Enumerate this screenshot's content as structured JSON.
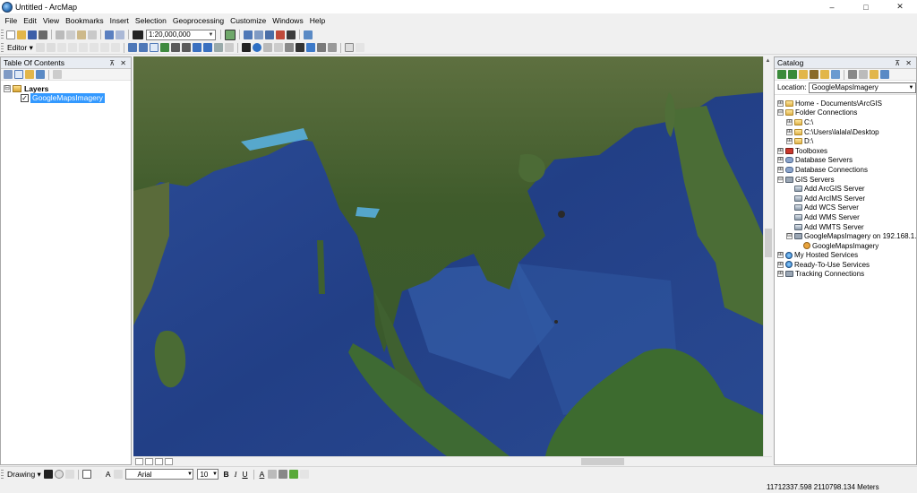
{
  "window": {
    "title": "Untitled - ArcMap",
    "minimize": "–",
    "maximize": "□",
    "close": "✕"
  },
  "menu": [
    "File",
    "Edit",
    "View",
    "Bookmarks",
    "Insert",
    "Selection",
    "Geoprocessing",
    "Customize",
    "Windows",
    "Help"
  ],
  "standard_toolbar": {
    "scale": "1:20,000,000"
  },
  "editor_toolbar": {
    "label": "Editor ▾"
  },
  "toc": {
    "title": "Table Of Contents",
    "pin_close": "⊼ ✕",
    "group": {
      "expander": "⊟",
      "label": "Layers"
    },
    "layers": [
      {
        "name": "GoogleMapsImagery",
        "checked": "✓"
      }
    ]
  },
  "catalog": {
    "title": "Catalog",
    "pin_close": "⊼ ✕",
    "location_label": "Location:",
    "location_value": "GoogleMapsImagery",
    "tree": [
      {
        "label": "Home - Documents\\ArcGIS",
        "exp": "⊞"
      },
      {
        "label": "Folder Connections",
        "exp": "⊟"
      },
      {
        "label": "C:\\",
        "exp": "⊞"
      },
      {
        "label": "C:\\Users\\lalala\\Desktop",
        "exp": "⊞"
      },
      {
        "label": "D:\\",
        "exp": "⊞"
      },
      {
        "label": "Toolboxes",
        "exp": "⊞"
      },
      {
        "label": "Database Servers",
        "exp": "⊞"
      },
      {
        "label": "Database Connections",
        "exp": "⊞"
      },
      {
        "label": "GIS Servers",
        "exp": "⊟"
      },
      {
        "label": "Add ArcGIS Server",
        "exp": ""
      },
      {
        "label": "Add ArcIMS Server",
        "exp": ""
      },
      {
        "label": "Add WCS Server",
        "exp": ""
      },
      {
        "label": "Add WMS Server",
        "exp": ""
      },
      {
        "label": "Add WMTS Server",
        "exp": ""
      },
      {
        "label": "GoogleMapsImagery on 192.168.1.",
        "exp": "⊟"
      },
      {
        "label": "GoogleMapsImagery",
        "exp": ""
      },
      {
        "label": "My Hosted Services",
        "exp": "⊞"
      },
      {
        "label": "Ready-To-Use Services",
        "exp": "⊞"
      },
      {
        "label": "Tracking Connections",
        "exp": "⊞"
      }
    ]
  },
  "drawing_toolbar": {
    "label": "Drawing ▾",
    "font": "Arial",
    "size": "10",
    "bold": "B",
    "italic": "I",
    "underline": "U",
    "font_color": "A",
    "text_tool": "A"
  },
  "status": {
    "coordinates": "11712337.598  2110798.134 Meters"
  },
  "colors": {
    "accent": "#3399ff",
    "panel_head": "#e8ecf2",
    "ocean": "#1f3f86"
  }
}
